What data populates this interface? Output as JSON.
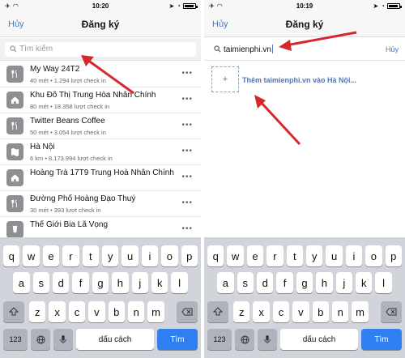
{
  "left": {
    "status": {
      "time": "10:20"
    },
    "nav": {
      "cancel": "Hủy",
      "title": "Đăng ký"
    },
    "search": {
      "placeholder": "Tìm kiếm"
    },
    "places": [
      {
        "title": "My Way 24T2",
        "sub": "40  mét • 1.294 lượt check in",
        "icon": "fork-knife-icon"
      },
      {
        "title": "Khu Đô Thị Trung Hòa Nhân Chính",
        "sub": "80  mét • 18.358 lượt check in",
        "icon": "home-icon"
      },
      {
        "title": "Twitter Beans Coffee",
        "sub": "50  mét • 3.054 lượt check in",
        "icon": "fork-knife-icon"
      },
      {
        "title": "Hà Nội",
        "sub": "6 km • 8.173.994 lượt check in",
        "icon": "map-icon"
      },
      {
        "title": "Hoàng Trà 17T9 Trung Hoà Nhân Chính",
        "sub": "",
        "icon": "home-icon"
      },
      {
        "title": "Đường Phố Hoàng Đạo Thuý",
        "sub": "30  mét • 393 lượt check in",
        "icon": "fork-knife-icon"
      },
      {
        "title": "Thế Giới Bia Lã Vọng",
        "sub": "",
        "icon": "glass-icon"
      }
    ]
  },
  "right": {
    "status": {
      "time": "10:19"
    },
    "nav": {
      "cancel": "Hủy",
      "title": "Đăng ký"
    },
    "search": {
      "value": "taimienphi.vn",
      "cancel": "Hủy"
    },
    "add_place": {
      "plus": "+",
      "label": "Thêm taimienphi.vn vào Hà Nội..."
    }
  },
  "keyboard": {
    "row1": [
      "q",
      "w",
      "e",
      "r",
      "t",
      "y",
      "u",
      "i",
      "o",
      "p"
    ],
    "row2": [
      "a",
      "s",
      "d",
      "f",
      "g",
      "h",
      "j",
      "k",
      "l"
    ],
    "row3": [
      "z",
      "x",
      "c",
      "v",
      "b",
      "n",
      "m"
    ],
    "numbers_label": "123",
    "space_label": "dấu cách",
    "done_label": "Tìm"
  },
  "colors": {
    "accent": "#4a78c7",
    "done_key": "#2f7ff0",
    "arrow": "#d8262f"
  }
}
